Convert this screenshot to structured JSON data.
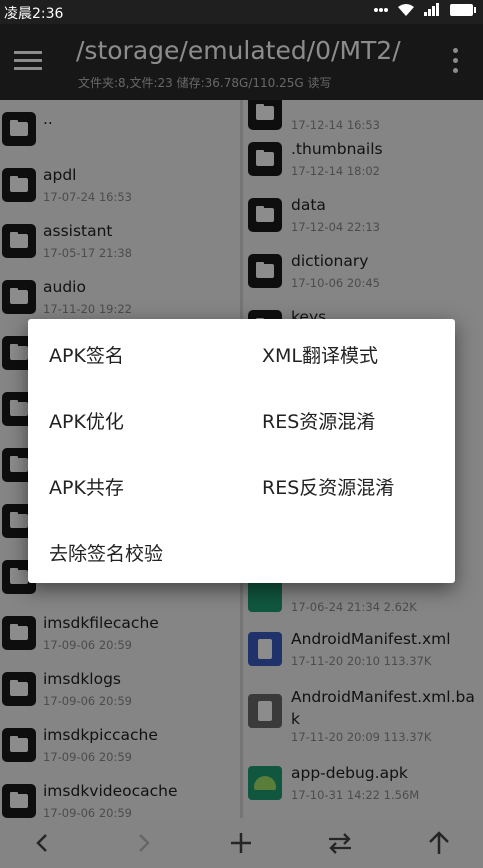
{
  "status_bar": {
    "time": "凌晨2:36"
  },
  "toolbar": {
    "path": "/storage/emulated/0/MT2/",
    "info": "文件夹:8,文件:23  储存:36.78G/110.25G  读写"
  },
  "left_pane": {
    "items": [
      {
        "name": "..",
        "meta": ""
      },
      {
        "name": "apdl",
        "meta": "17-07-24 16:53"
      },
      {
        "name": "assistant",
        "meta": "17-05-17 21:38"
      },
      {
        "name": "audio",
        "meta": "17-11-20 19:22"
      },
      {
        "name": "",
        "meta": ""
      },
      {
        "name": "",
        "meta": ""
      },
      {
        "name": "",
        "meta": ""
      },
      {
        "name": "",
        "meta": ""
      },
      {
        "name": "",
        "meta": ""
      },
      {
        "name": "imsdkfilecache",
        "meta": "17-09-06 20:59"
      },
      {
        "name": "imsdklogs",
        "meta": "17-09-06 20:59"
      },
      {
        "name": "imsdkpiccache",
        "meta": "17-09-06 20:59"
      },
      {
        "name": "imsdkvideocache",
        "meta": "17-09-06 20:59"
      }
    ]
  },
  "right_pane": {
    "items": [
      {
        "name": "",
        "meta": "17-12-14 16:53",
        "type": "folder"
      },
      {
        "name": ".thumbnails",
        "meta": "17-12-14 18:02",
        "type": "folder"
      },
      {
        "name": "data",
        "meta": "17-12-04 22:13",
        "type": "folder"
      },
      {
        "name": "dictionary",
        "meta": "17-10-06 20:45",
        "type": "folder"
      },
      {
        "name": "keys",
        "meta": "",
        "type": "folder"
      },
      {
        "name": "",
        "meta": "17-06-24 21:34  2.62K",
        "type": "file-green"
      },
      {
        "name": "AndroidManifest.xml",
        "meta": "17-11-20 20:10  113.37K",
        "type": "file-blue"
      },
      {
        "name": "AndroidManifest.xml.bak",
        "meta": "17-11-20 20:09  113.37K",
        "type": "file-gray"
      },
      {
        "name": "app-debug.apk",
        "meta": "17-10-31 14:22  1.56M",
        "type": "apk"
      }
    ]
  },
  "dialog": {
    "options": [
      "APK签名",
      "XML翻译模式",
      "APK优化",
      "RES资源混淆",
      "APK共存",
      "RES反资源混淆",
      "去除签名校验"
    ]
  },
  "colors": {
    "toolbar": "#2b2b2b",
    "folder": "#1b1b1b",
    "xml_blue": "#3a5bbf",
    "apk_green": "#1f9e74"
  }
}
